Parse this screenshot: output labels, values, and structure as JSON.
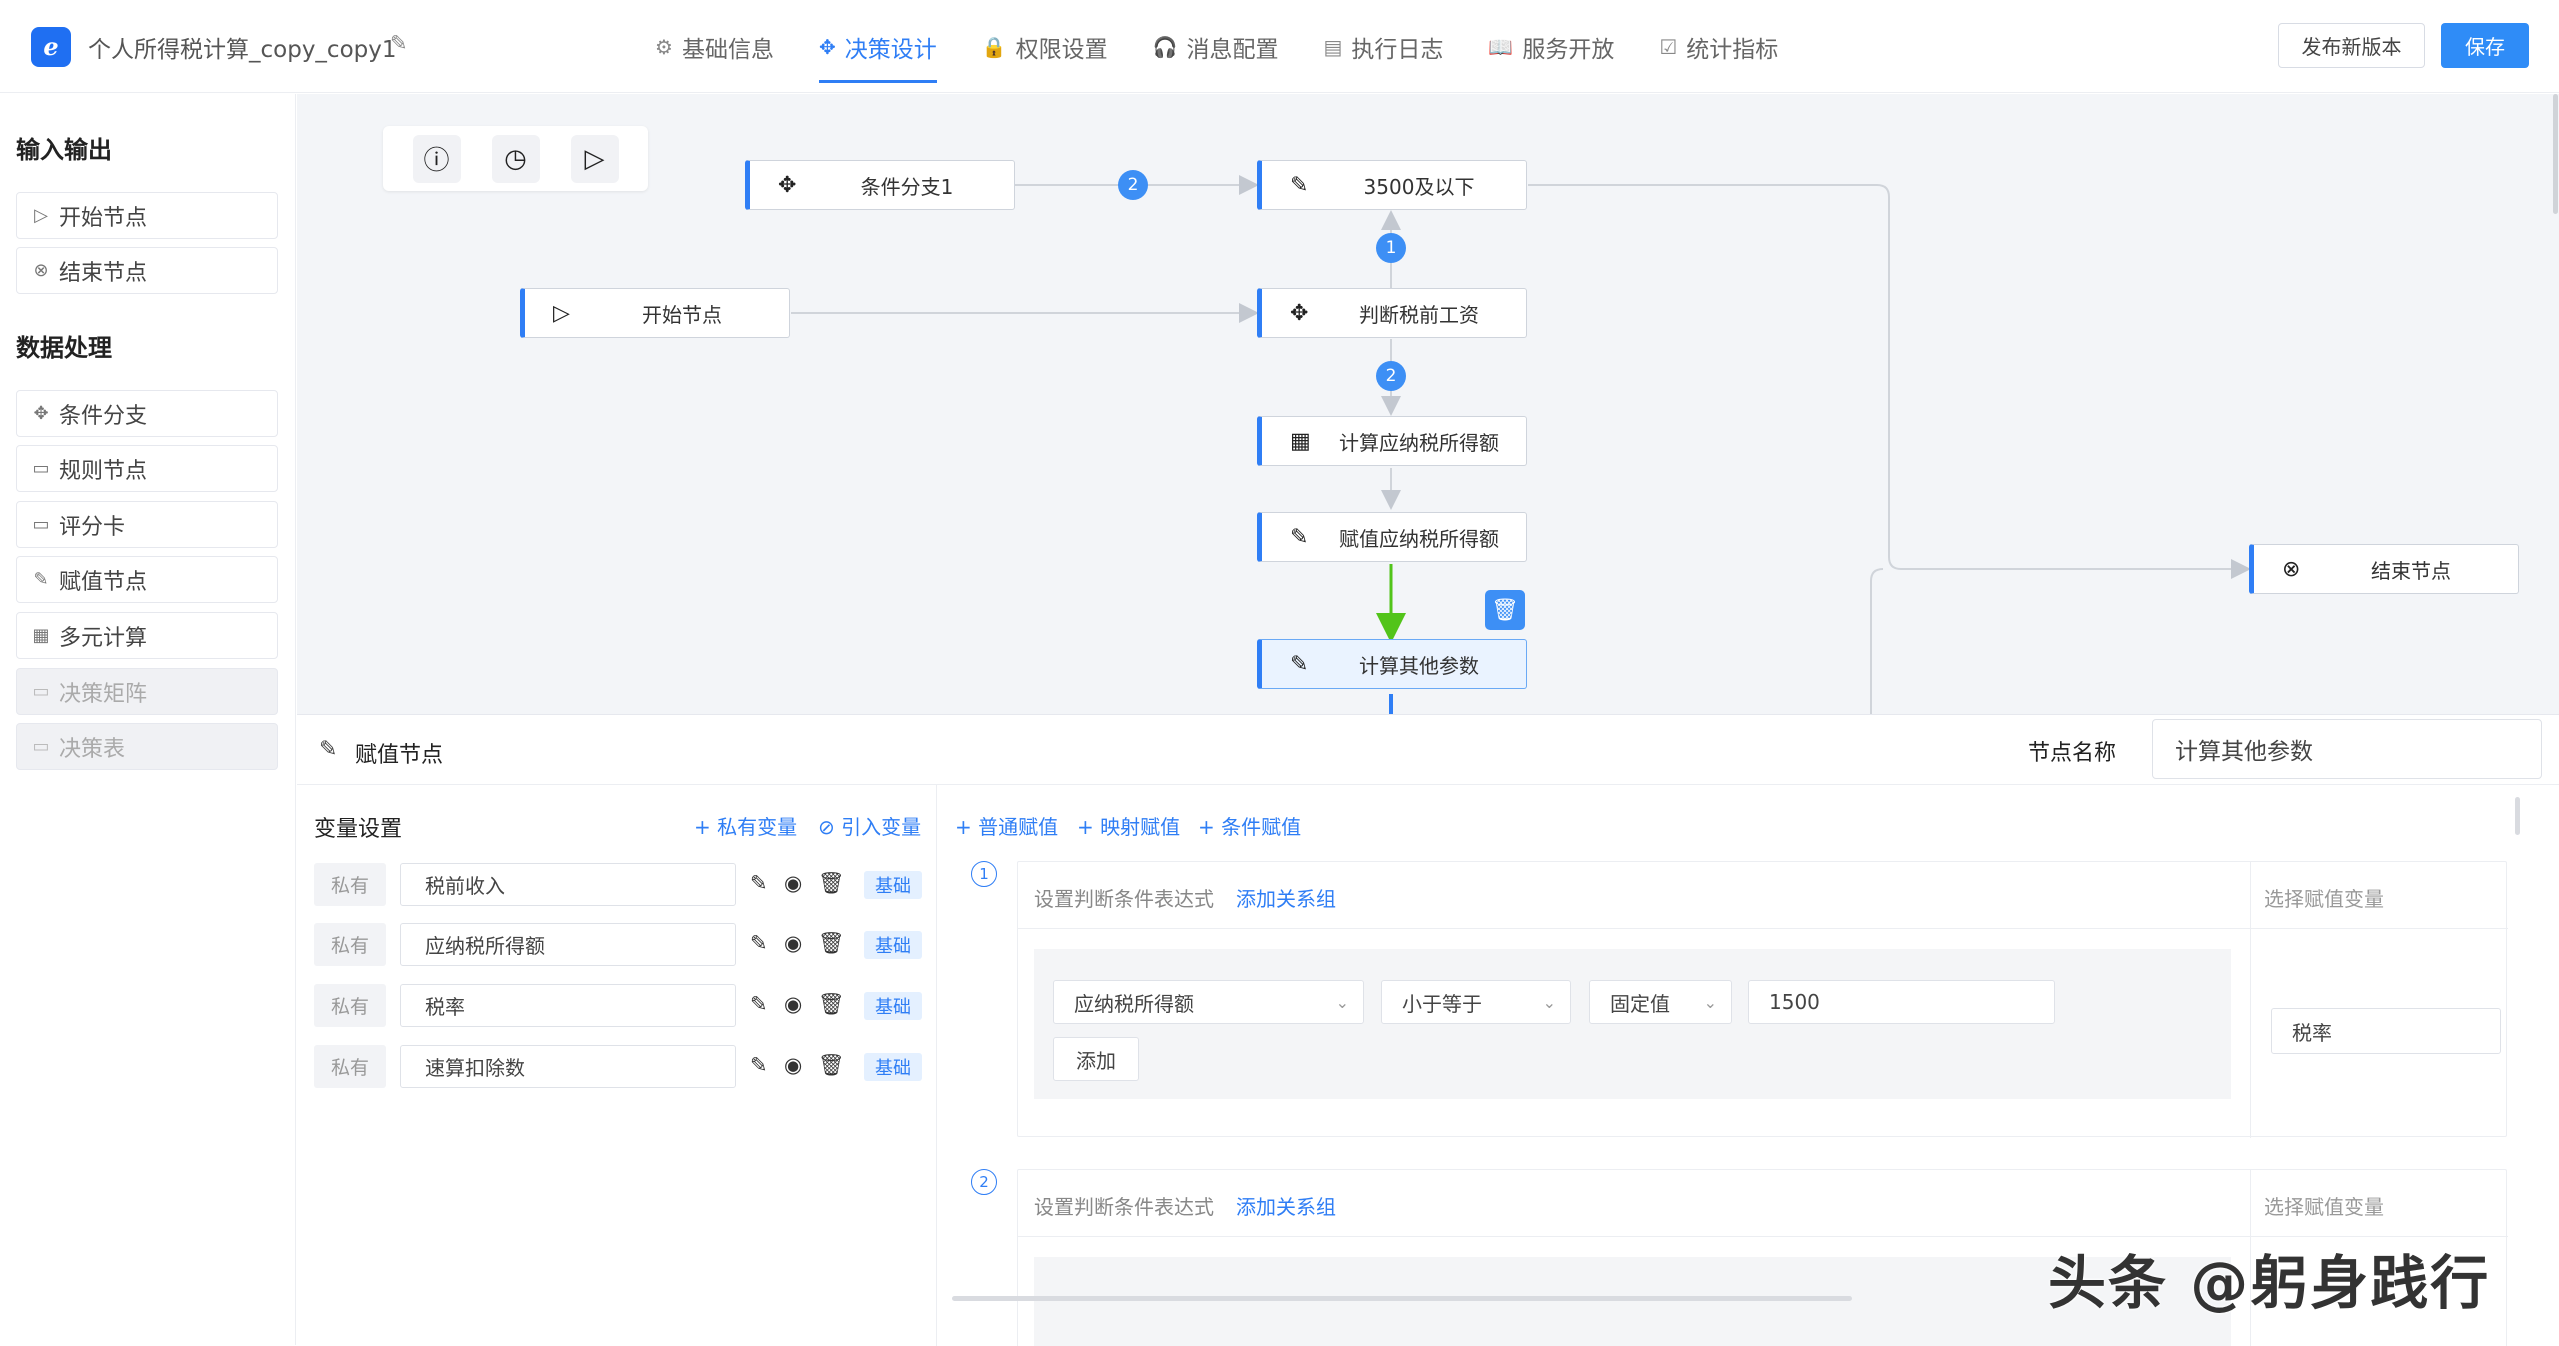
{
  "header": {
    "title": "个人所得税计算_copy_copy1",
    "tabs": [
      {
        "label": "基础信息",
        "icon": "⚙"
      },
      {
        "label": "决策设计",
        "icon": "✥"
      },
      {
        "label": "权限设置",
        "icon": "🔒"
      },
      {
        "label": "消息配置",
        "icon": "🎧"
      },
      {
        "label": "执行日志",
        "icon": "▤"
      },
      {
        "label": "服务开放",
        "icon": "📖"
      },
      {
        "label": "统计指标",
        "icon": "☑"
      }
    ],
    "publish_label": "发布新版本",
    "save_label": "保存"
  },
  "sidebar": {
    "section1": "输入输出",
    "io_items": [
      "开始节点",
      "结束节点"
    ],
    "section2": "数据处理",
    "proc_items": [
      "条件分支",
      "规则节点",
      "评分卡",
      "赋值节点",
      "多元计算",
      "决策矩阵",
      "决策表"
    ]
  },
  "canvas": {
    "nodes": {
      "branch1": "条件分支1",
      "under3500": "3500及以下",
      "start": "开始节点",
      "judge": "判断税前工资",
      "calc_taxable": "计算应纳税所得额",
      "assign_taxable": "赋值应纳税所得额",
      "calc_other": "计算其他参数",
      "end": "结束节点"
    },
    "badges": {
      "b1": "2",
      "b2": "1",
      "b3": "2"
    }
  },
  "panel": {
    "node_type": "赋值节点",
    "node_name_label": "节点名称",
    "node_name_value": "计算其他参数",
    "var_title": "变量设置",
    "add_private": "+ 私有变量",
    "import_var": "⊘ 引入变量",
    "variables": [
      {
        "scope": "私有",
        "name": "税前收入",
        "type": "基础"
      },
      {
        "scope": "私有",
        "name": "应纳税所得额",
        "type": "基础"
      },
      {
        "scope": "私有",
        "name": "税率",
        "type": "基础"
      },
      {
        "scope": "私有",
        "name": "速算扣除数",
        "type": "基础"
      }
    ],
    "assign_links": [
      "+ 普通赋值",
      "+ 映射赋值",
      "+ 条件赋值"
    ],
    "rules": [
      {
        "num": "1",
        "cond_label": "设置判断条件表达式",
        "add_group": "添加关系组",
        "select_label": "选择赋值变量",
        "field": "应纳税所得额",
        "operator": "小于等于",
        "value_type": "固定值",
        "value": "1500",
        "add_label": "添加",
        "assign_var": "税率"
      },
      {
        "num": "2",
        "cond_label": "设置判断条件表达式",
        "add_group": "添加关系组",
        "select_label": "选择赋值变量"
      }
    ]
  },
  "watermark": "头条 @躬身践行",
  "colors": {
    "accent": "#2f7ef5",
    "edge_highlight": "#52c41a"
  }
}
